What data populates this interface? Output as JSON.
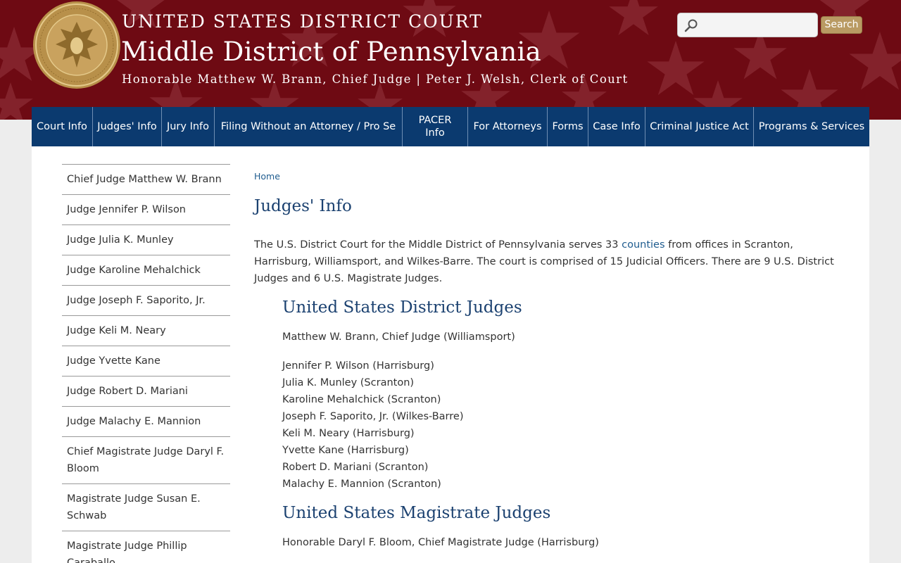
{
  "header": {
    "line1": "UNITED STATES DISTRICT COURT",
    "line2": "Middle District of Pennsylvania",
    "line3": "Honorable Matthew W. Brann, Chief Judge | Peter J. Welsh, Clerk of Court",
    "seal_icon": "court-seal-icon",
    "colors": {
      "banner": "#6e0a13",
      "nav": "#0b3a6f",
      "search_button": "#b99a63"
    }
  },
  "search": {
    "placeholder": "",
    "button_label": "Search",
    "icon": "search-icon"
  },
  "nav": {
    "items": [
      {
        "label": "Court Info"
      },
      {
        "label": "Judges' Info"
      },
      {
        "label": "Jury Info"
      },
      {
        "label": "Filing Without an Attorney / Pro Se"
      },
      {
        "label": "PACER Info"
      },
      {
        "label": "For Attorneys"
      },
      {
        "label": "Forms"
      },
      {
        "label": "Case Info"
      },
      {
        "label": "Criminal Justice Act"
      },
      {
        "label": "Programs & Services"
      }
    ]
  },
  "sidebar": {
    "items": [
      {
        "label": "Chief Judge Matthew W. Brann"
      },
      {
        "label": "Judge Jennifer P. Wilson"
      },
      {
        "label": "Judge Julia K. Munley"
      },
      {
        "label": "Judge Karoline Mehalchick"
      },
      {
        "label": "Judge Joseph F. Saporito, Jr."
      },
      {
        "label": "Judge Keli M. Neary"
      },
      {
        "label": "Judge Yvette Kane"
      },
      {
        "label": "Judge Robert D. Mariani"
      },
      {
        "label": "Judge Malachy E. Mannion"
      },
      {
        "label": "Chief Magistrate Judge Daryl F. Bloom"
      },
      {
        "label": "Magistrate Judge Susan E. Schwab"
      },
      {
        "label": "Magistrate Judge Phillip Caraballo"
      }
    ]
  },
  "content": {
    "breadcrumb": "Home",
    "title": "Judges' Info",
    "intro_before_link": "The U.S. District Court for the Middle District of Pennsylvania serves 33 ",
    "intro_link": "counties",
    "intro_after_link": " from offices in Scranton, Harrisburg, Williamsport, and Wilkes-Barre. The court is comprised of 15 Judicial Officers. There are 9 U.S. District Judges and 6 U.S. Magistrate Judges.",
    "district_heading": "United States District Judges",
    "chief_judge_line": "Matthew W. Brann, Chief Judge (Williamsport)",
    "district_judges": [
      "Jennifer P. Wilson (Harrisburg)",
      "Julia K. Munley (Scranton)",
      "Karoline Mehalchick (Scranton)",
      "Joseph F. Saporito, Jr. (Wilkes-Barre)",
      "Keli M. Neary (Harrisburg)",
      "Yvette Kane (Harrisburg)",
      "Robert D. Mariani (Scranton)",
      "Malachy E. Mannion (Scranton)"
    ],
    "magistrate_heading": "United States Magistrate Judges",
    "chief_magistrate_line": "Honorable Daryl F. Bloom, Chief Magistrate Judge (Harrisburg)"
  }
}
